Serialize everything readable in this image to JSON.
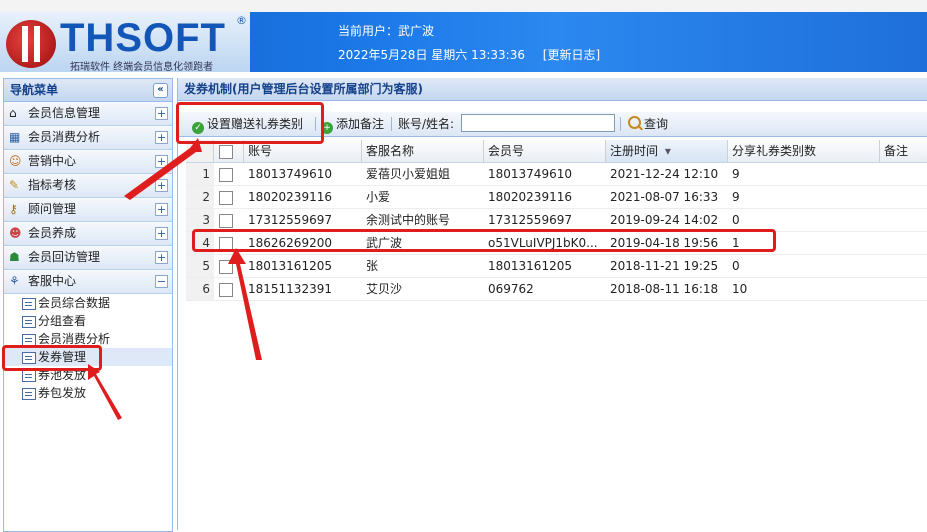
{
  "header": {
    "logo_text": "THSOFT",
    "logo_reg": "®",
    "logo_sub": "拓瑞软件  终端会员信息化领跑者",
    "user_label": "当前用户：",
    "user_name": "武广波",
    "datetime": "2022年5月28日 星期六 13:33:36",
    "update_log": "[更新日志]"
  },
  "nav": {
    "title": "导航菜单",
    "collapse": "«",
    "sections": [
      {
        "label": "会员信息管理",
        "icon": "home-icon",
        "toggle": "+"
      },
      {
        "label": "会员消费分析",
        "icon": "report-icon",
        "toggle": "+"
      },
      {
        "label": "营销中心",
        "icon": "users-icon",
        "toggle": "+"
      },
      {
        "label": "指标考核",
        "icon": "edit-icon",
        "toggle": "+"
      },
      {
        "label": "顾问管理",
        "icon": "key-icon",
        "toggle": "+"
      },
      {
        "label": "会员养成",
        "icon": "user-icon",
        "toggle": "+"
      },
      {
        "label": "会员回访管理",
        "icon": "group-icon",
        "toggle": "+"
      },
      {
        "label": "客服中心",
        "icon": "chart-icon",
        "toggle": "−"
      }
    ],
    "sub_items": [
      "会员综合数据",
      "分组查看",
      "会员消费分析",
      "发券管理",
      "券池发放",
      "券包发放"
    ]
  },
  "main": {
    "title": "发券机制(用户管理后台设置所属部门为客服)",
    "toolbar": {
      "set_gift_type": "设置赠送礼券类别",
      "add_note": "添加备注",
      "search_label": "账号/姓名:",
      "search_value": "",
      "query": "查询"
    },
    "columns": [
      "账号",
      "客服名称",
      "会员号",
      "注册时间",
      "分享礼券类别数",
      "备注"
    ],
    "sort_indicator": "▾",
    "rows": [
      {
        "n": "1",
        "account": "18013749610",
        "name": "爱蓓贝小爱姐姐",
        "member": "18013749610",
        "reg": "2021-12-24 12:10",
        "count": "9",
        "note": ""
      },
      {
        "n": "2",
        "account": "18020239116",
        "name": "小爱",
        "member": "18020239116",
        "reg": "2021-08-07 16:33",
        "count": "9",
        "note": ""
      },
      {
        "n": "3",
        "account": "17312559697",
        "name": "余测试中的账号",
        "member": "17312559697",
        "reg": "2019-09-24 14:02",
        "count": "0",
        "note": ""
      },
      {
        "n": "4",
        "account": "18626269200",
        "name": "武广波",
        "member": "o51VLuIVPJ1bK0...",
        "reg": "2019-04-18 19:56",
        "count": "1",
        "note": ""
      },
      {
        "n": "5",
        "account": "18013161205",
        "name": "张",
        "member": "18013161205",
        "reg": "2018-11-21 19:25",
        "count": "0",
        "note": ""
      },
      {
        "n": "6",
        "account": "18151132391",
        "name": "艾贝沙",
        "member": "069762",
        "reg": "2018-08-11 16:18",
        "count": "10",
        "note": ""
      }
    ]
  },
  "colors": {
    "accent": "#15428b",
    "header": "#1c79e8",
    "annotation": "#e01d1d",
    "add_icon": "#3aa33a"
  }
}
